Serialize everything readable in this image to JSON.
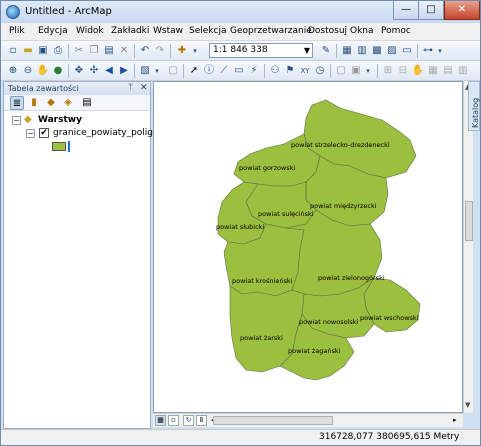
{
  "window": {
    "title": "Untitled - ArcMap",
    "controls": {
      "minimize": "—",
      "maximize": "□",
      "close": "✕"
    }
  },
  "menu": {
    "items": [
      "Plik",
      "Edycja",
      "Widok",
      "Zakładki",
      "Wstaw",
      "Selekcja",
      "Geoprzetwarzanie",
      "Dostosuj",
      "Okna",
      "Pomoc"
    ]
  },
  "toolbar": {
    "scale_value": "1:1 846 338"
  },
  "toc": {
    "title": "Tabela zawartości",
    "pin": "ᛘ",
    "close": "✕",
    "group_label": "Warstwy",
    "layer_label": "granice_powiaty_poligon",
    "layer_checked": "✔",
    "layer_color": "#9bbf3f"
  },
  "map": {
    "fill_color": "#9bbf3f",
    "counties": [
      "powiat strzelecko-drezdenecki",
      "powiat gorzowski",
      "powiat międzyrzecki",
      "powiat sulęciński",
      "powiat słubicki",
      "powiat krośnieński",
      "powiat zielonogórski",
      "powiat wschowski",
      "powiat nowosolski",
      "powiat żarski",
      "powiat żagański"
    ]
  },
  "side_tab": {
    "label": "Katalog"
  },
  "status": {
    "coordinates": "316728,077  380695,615 Metry"
  }
}
